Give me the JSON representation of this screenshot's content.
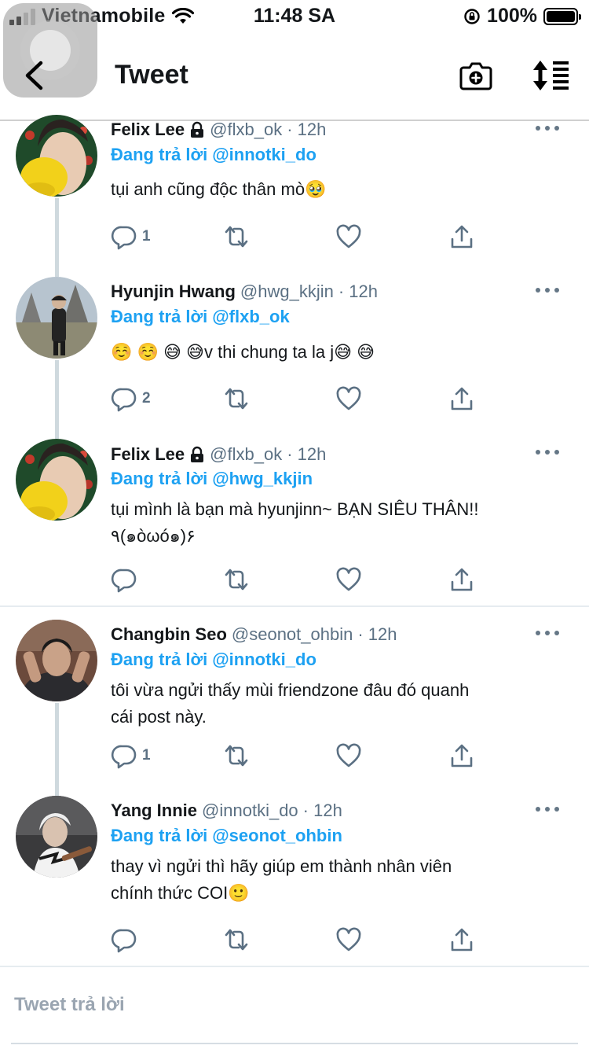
{
  "status_bar": {
    "carrier": "Vietnamobile",
    "time": "11:48 SA",
    "battery": "100%"
  },
  "header": {
    "title": "Tweet"
  },
  "tweets": [
    {
      "name": "Felix Lee",
      "handle": "@flxb_ok",
      "time": "· 12h",
      "locked": true,
      "reply_prefix": "Đang trả lời",
      "reply_to": "@innotki_do",
      "text": "tụi anh cũng độc thân mò🥹",
      "reply_count": "1"
    },
    {
      "name": "Hyunjin Hwang",
      "handle": "@hwg_kkjin",
      "time": "· 12h",
      "locked": false,
      "reply_prefix": "Đang trả lời",
      "reply_to": "@flxb_ok",
      "text": "☺️ ☺️ 😅 😅v thi chung ta la j😅 😅",
      "reply_count": "2"
    },
    {
      "name": "Felix Lee",
      "handle": "@flxb_ok",
      "time": "· 12h",
      "locked": true,
      "reply_prefix": "Đang trả lời",
      "reply_to": "@hwg_kkjin",
      "text": "tụi mình là bạn mà hyunjinn~ BẠN SIÊU THÂN!!\n٩(๑òωó๑)۶",
      "reply_count": ""
    },
    {
      "name": "Changbin Seo",
      "handle": "@seonot_ohbin",
      "time": "· 12h",
      "locked": false,
      "reply_prefix": "Đang trả lời",
      "reply_to": "@innotki_do",
      "text": "tôi vừa ngửi thấy mùi friendzone đâu đó quanh\ncái post này.",
      "reply_count": "1"
    },
    {
      "name": "Yang Innie",
      "handle": "@innotki_do",
      "time": "· 12h",
      "locked": false,
      "reply_prefix": "Đang trả lời",
      "reply_to": "@seonot_ohbin",
      "text": "thay vì ngửi thì hãy giúp em thành nhân viên\nchính thức COI🙂",
      "reply_count": ""
    }
  ],
  "compose": {
    "placeholder": "Tweet trả lời"
  },
  "colors": {
    "accent": "#1da1f2",
    "text": "#14171a",
    "secondary": "#5b7083",
    "divider": "#e6ecf0"
  },
  "icons": [
    "back-icon",
    "camera-plus-icon",
    "sort-icon",
    "lock-icon",
    "more-icon",
    "reply-icon",
    "retweet-icon",
    "like-icon",
    "share-icon"
  ]
}
